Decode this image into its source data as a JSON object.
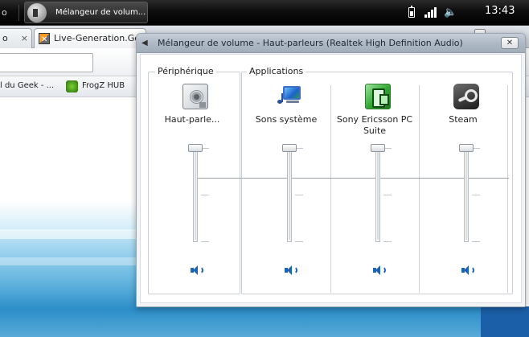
{
  "taskbar": {
    "left_fragment": "o",
    "active_task": "Mélangeur de volum...",
    "clock": "13:43"
  },
  "browser": {
    "tabs": [
      {
        "label": "o"
      },
      {
        "label": "Live-Generation.Geek"
      }
    ],
    "bookmarks": [
      {
        "label": "l du Geek - ..."
      },
      {
        "label": "FrogZ HUB"
      }
    ]
  },
  "mixer": {
    "title": "Mélangeur de volume - Haut-parleurs (Realtek High Definition Audio)",
    "close_label": "✕",
    "device_group_label": "Périphérique",
    "apps_group_label": "Applications",
    "channels": [
      {
        "name": "Haut-parle...",
        "icon": "speaker-device-icon",
        "level": 1.0
      },
      {
        "name": "Sons système",
        "icon": "system-sounds-icon",
        "level": 1.0
      },
      {
        "name": "Sony Ericsson PC Suite",
        "icon": "sony-ericsson-icon",
        "level": 1.0
      },
      {
        "name": "Steam",
        "icon": "steam-icon",
        "level": 1.0
      }
    ]
  },
  "colors": {
    "accent": "#1e64b4",
    "taskbar": "#000000",
    "window_frame": "#aeb9c5"
  }
}
